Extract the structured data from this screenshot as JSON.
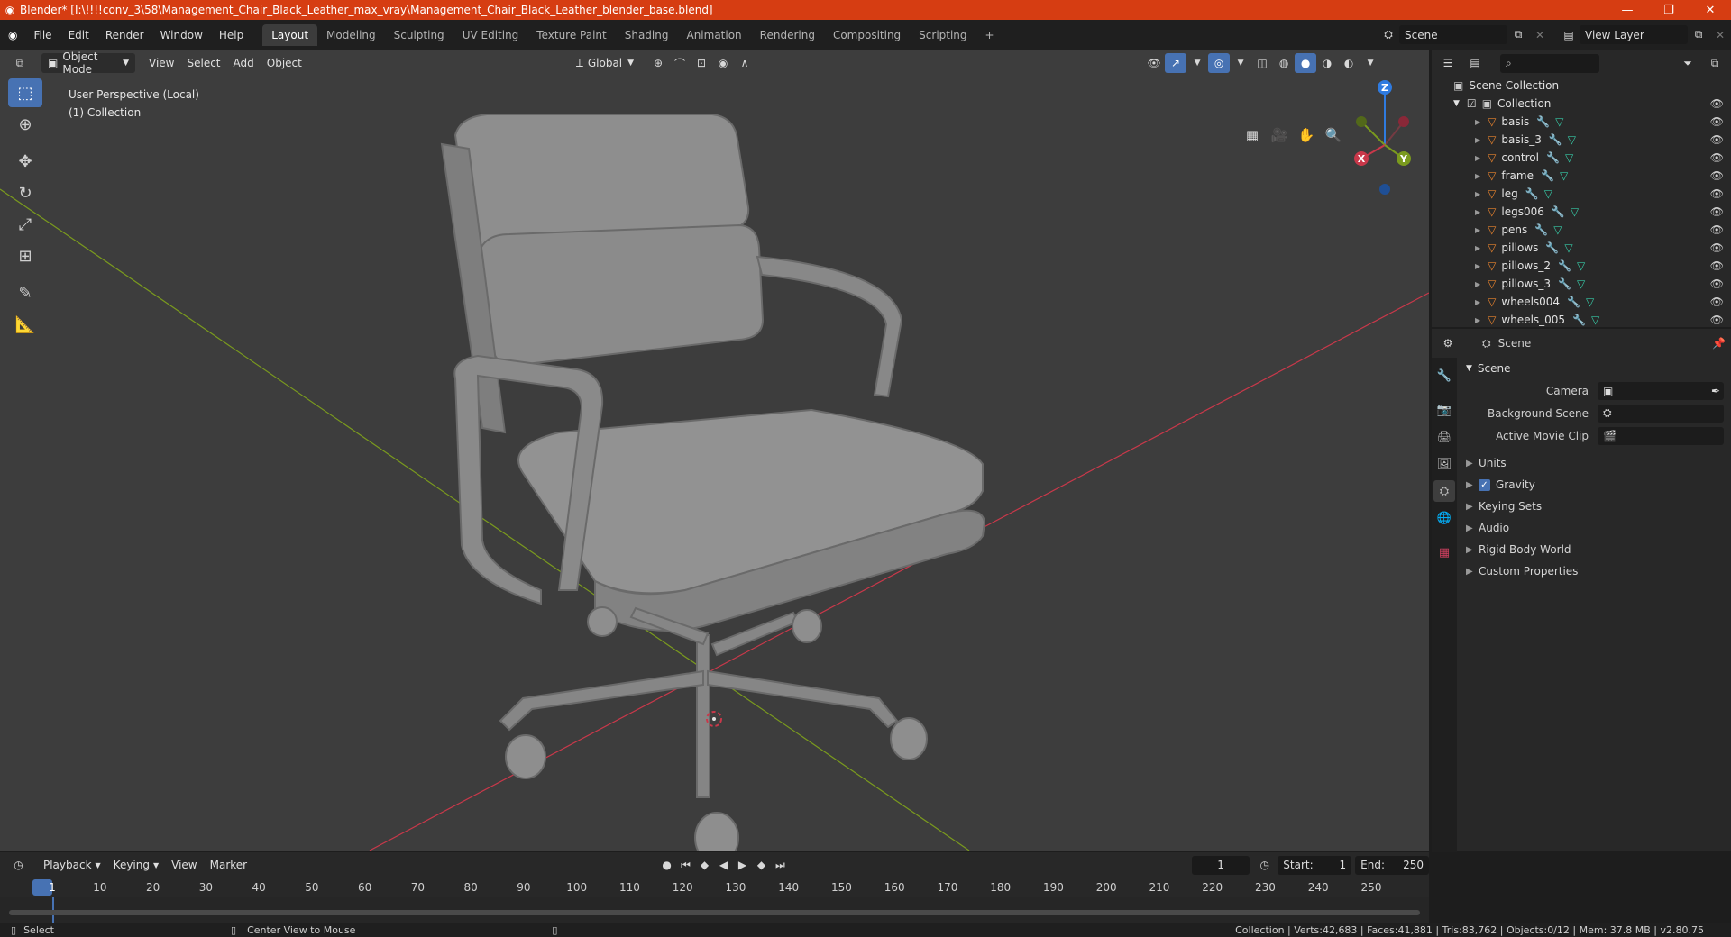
{
  "titlebar": {
    "title": "Blender* [I:\\!!!!conv_3\\58\\Management_Chair_Black_Leather_max_vray\\Management_Chair_Black_Leather_blender_base.blend]"
  },
  "menu": [
    "File",
    "Edit",
    "Render",
    "Window",
    "Help"
  ],
  "tabs": [
    "Layout",
    "Modeling",
    "Sculpting",
    "UV Editing",
    "Texture Paint",
    "Shading",
    "Animation",
    "Rendering",
    "Compositing",
    "Scripting"
  ],
  "active_tab": "Layout",
  "scene_field": "Scene",
  "view_layer_field": "View Layer",
  "viewport": {
    "mode": "Object Mode",
    "menus": [
      "View",
      "Select",
      "Add",
      "Object"
    ],
    "transform_orientation": "Global",
    "info_line1": "User Perspective (Local)",
    "info_line2": "(1) Collection",
    "gizmo": {
      "x": "X",
      "y": "Y",
      "z": "Z"
    }
  },
  "outliner": {
    "root": "Scene Collection",
    "collection": "Collection",
    "objects": [
      "basis",
      "basis_3",
      "control",
      "frame",
      "leg",
      "legs006",
      "pens",
      "pillows",
      "pillows_2",
      "pillows_3",
      "wheels004",
      "wheels_005"
    ]
  },
  "properties": {
    "header": "Scene",
    "panel": "Scene",
    "fields": [
      {
        "label": "Camera",
        "value": ""
      },
      {
        "label": "Background Scene",
        "value": ""
      },
      {
        "label": "Active Movie Clip",
        "value": ""
      }
    ],
    "subpanels": [
      "Units",
      "Gravity",
      "Keying Sets",
      "Audio",
      "Rigid Body World",
      "Custom Properties"
    ],
    "gravity_checked": true
  },
  "timeline": {
    "menus": [
      "Playback",
      "Keying",
      "View",
      "Marker"
    ],
    "current_frame": "1",
    "start_label": "Start:",
    "start": "1",
    "end_label": "End:",
    "end": "250",
    "ticks": [
      "1",
      "10",
      "20",
      "30",
      "40",
      "50",
      "60",
      "70",
      "80",
      "90",
      "100",
      "110",
      "120",
      "130",
      "140",
      "150",
      "160",
      "170",
      "180",
      "190",
      "200",
      "210",
      "220",
      "230",
      "240",
      "250"
    ]
  },
  "status": {
    "left": "Select",
    "middle": "Center View to Mouse",
    "right": "Collection | Verts:42,683 | Faces:41,881 | Tris:83,762 | Objects:0/12 | Mem: 37.8 MB | v2.80.75"
  },
  "colors": {
    "title_bg": "#d63d12",
    "accent": "#4772b3",
    "x_axis": "#c9384a",
    "y_axis": "#7a9a1e",
    "z_axis": "#2f7be0"
  }
}
